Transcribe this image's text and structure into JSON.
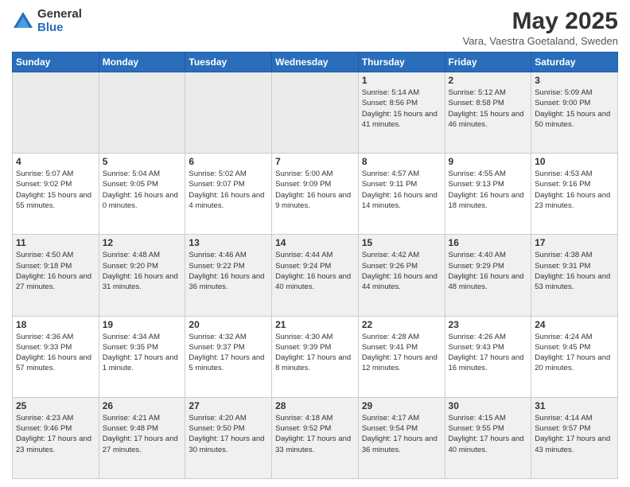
{
  "logo": {
    "general": "General",
    "blue": "Blue"
  },
  "title": "May 2025",
  "location": "Vara, Vaestra Goetaland, Sweden",
  "weekdays": [
    "Sunday",
    "Monday",
    "Tuesday",
    "Wednesday",
    "Thursday",
    "Friday",
    "Saturday"
  ],
  "weeks": [
    [
      {
        "day": "",
        "sunrise": "",
        "sunset": "",
        "daylight": ""
      },
      {
        "day": "",
        "sunrise": "",
        "sunset": "",
        "daylight": ""
      },
      {
        "day": "",
        "sunrise": "",
        "sunset": "",
        "daylight": ""
      },
      {
        "day": "",
        "sunrise": "",
        "sunset": "",
        "daylight": ""
      },
      {
        "day": "1",
        "sunrise": "Sunrise: 5:14 AM",
        "sunset": "Sunset: 8:56 PM",
        "daylight": "Daylight: 15 hours and 41 minutes."
      },
      {
        "day": "2",
        "sunrise": "Sunrise: 5:12 AM",
        "sunset": "Sunset: 8:58 PM",
        "daylight": "Daylight: 15 hours and 46 minutes."
      },
      {
        "day": "3",
        "sunrise": "Sunrise: 5:09 AM",
        "sunset": "Sunset: 9:00 PM",
        "daylight": "Daylight: 15 hours and 50 minutes."
      }
    ],
    [
      {
        "day": "4",
        "sunrise": "Sunrise: 5:07 AM",
        "sunset": "Sunset: 9:02 PM",
        "daylight": "Daylight: 15 hours and 55 minutes."
      },
      {
        "day": "5",
        "sunrise": "Sunrise: 5:04 AM",
        "sunset": "Sunset: 9:05 PM",
        "daylight": "Daylight: 16 hours and 0 minutes."
      },
      {
        "day": "6",
        "sunrise": "Sunrise: 5:02 AM",
        "sunset": "Sunset: 9:07 PM",
        "daylight": "Daylight: 16 hours and 4 minutes."
      },
      {
        "day": "7",
        "sunrise": "Sunrise: 5:00 AM",
        "sunset": "Sunset: 9:09 PM",
        "daylight": "Daylight: 16 hours and 9 minutes."
      },
      {
        "day": "8",
        "sunrise": "Sunrise: 4:57 AM",
        "sunset": "Sunset: 9:11 PM",
        "daylight": "Daylight: 16 hours and 14 minutes."
      },
      {
        "day": "9",
        "sunrise": "Sunrise: 4:55 AM",
        "sunset": "Sunset: 9:13 PM",
        "daylight": "Daylight: 16 hours and 18 minutes."
      },
      {
        "day": "10",
        "sunrise": "Sunrise: 4:53 AM",
        "sunset": "Sunset: 9:16 PM",
        "daylight": "Daylight: 16 hours and 23 minutes."
      }
    ],
    [
      {
        "day": "11",
        "sunrise": "Sunrise: 4:50 AM",
        "sunset": "Sunset: 9:18 PM",
        "daylight": "Daylight: 16 hours and 27 minutes."
      },
      {
        "day": "12",
        "sunrise": "Sunrise: 4:48 AM",
        "sunset": "Sunset: 9:20 PM",
        "daylight": "Daylight: 16 hours and 31 minutes."
      },
      {
        "day": "13",
        "sunrise": "Sunrise: 4:46 AM",
        "sunset": "Sunset: 9:22 PM",
        "daylight": "Daylight: 16 hours and 36 minutes."
      },
      {
        "day": "14",
        "sunrise": "Sunrise: 4:44 AM",
        "sunset": "Sunset: 9:24 PM",
        "daylight": "Daylight: 16 hours and 40 minutes."
      },
      {
        "day": "15",
        "sunrise": "Sunrise: 4:42 AM",
        "sunset": "Sunset: 9:26 PM",
        "daylight": "Daylight: 16 hours and 44 minutes."
      },
      {
        "day": "16",
        "sunrise": "Sunrise: 4:40 AM",
        "sunset": "Sunset: 9:29 PM",
        "daylight": "Daylight: 16 hours and 48 minutes."
      },
      {
        "day": "17",
        "sunrise": "Sunrise: 4:38 AM",
        "sunset": "Sunset: 9:31 PM",
        "daylight": "Daylight: 16 hours and 53 minutes."
      }
    ],
    [
      {
        "day": "18",
        "sunrise": "Sunrise: 4:36 AM",
        "sunset": "Sunset: 9:33 PM",
        "daylight": "Daylight: 16 hours and 57 minutes."
      },
      {
        "day": "19",
        "sunrise": "Sunrise: 4:34 AM",
        "sunset": "Sunset: 9:35 PM",
        "daylight": "Daylight: 17 hours and 1 minute."
      },
      {
        "day": "20",
        "sunrise": "Sunrise: 4:32 AM",
        "sunset": "Sunset: 9:37 PM",
        "daylight": "Daylight: 17 hours and 5 minutes."
      },
      {
        "day": "21",
        "sunrise": "Sunrise: 4:30 AM",
        "sunset": "Sunset: 9:39 PM",
        "daylight": "Daylight: 17 hours and 8 minutes."
      },
      {
        "day": "22",
        "sunrise": "Sunrise: 4:28 AM",
        "sunset": "Sunset: 9:41 PM",
        "daylight": "Daylight: 17 hours and 12 minutes."
      },
      {
        "day": "23",
        "sunrise": "Sunrise: 4:26 AM",
        "sunset": "Sunset: 9:43 PM",
        "daylight": "Daylight: 17 hours and 16 minutes."
      },
      {
        "day": "24",
        "sunrise": "Sunrise: 4:24 AM",
        "sunset": "Sunset: 9:45 PM",
        "daylight": "Daylight: 17 hours and 20 minutes."
      }
    ],
    [
      {
        "day": "25",
        "sunrise": "Sunrise: 4:23 AM",
        "sunset": "Sunset: 9:46 PM",
        "daylight": "Daylight: 17 hours and 23 minutes."
      },
      {
        "day": "26",
        "sunrise": "Sunrise: 4:21 AM",
        "sunset": "Sunset: 9:48 PM",
        "daylight": "Daylight: 17 hours and 27 minutes."
      },
      {
        "day": "27",
        "sunrise": "Sunrise: 4:20 AM",
        "sunset": "Sunset: 9:50 PM",
        "daylight": "Daylight: 17 hours and 30 minutes."
      },
      {
        "day": "28",
        "sunrise": "Sunrise: 4:18 AM",
        "sunset": "Sunset: 9:52 PM",
        "daylight": "Daylight: 17 hours and 33 minutes."
      },
      {
        "day": "29",
        "sunrise": "Sunrise: 4:17 AM",
        "sunset": "Sunset: 9:54 PM",
        "daylight": "Daylight: 17 hours and 36 minutes."
      },
      {
        "day": "30",
        "sunrise": "Sunrise: 4:15 AM",
        "sunset": "Sunset: 9:55 PM",
        "daylight": "Daylight: 17 hours and 40 minutes."
      },
      {
        "day": "31",
        "sunrise": "Sunrise: 4:14 AM",
        "sunset": "Sunset: 9:57 PM",
        "daylight": "Daylight: 17 hours and 43 minutes."
      }
    ]
  ]
}
